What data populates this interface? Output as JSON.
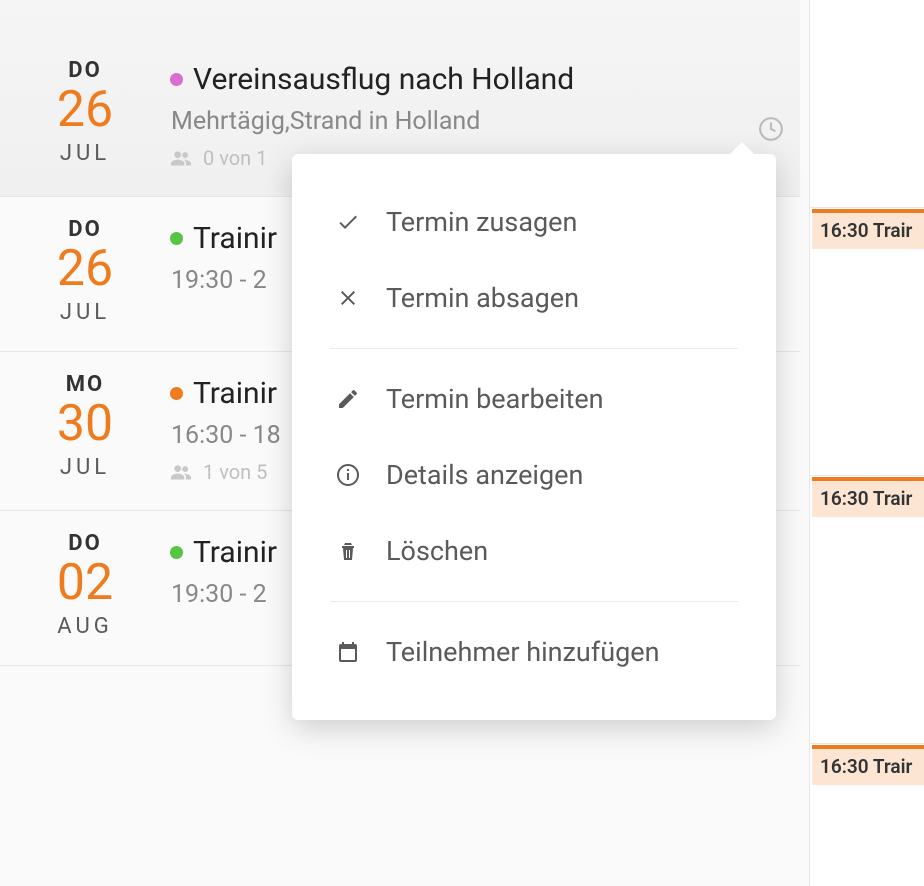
{
  "events": [
    {
      "weekday": "DO",
      "day": "26",
      "month": "JUL",
      "dot_color": "pink",
      "title": "Vereinsausflug nach Holland",
      "subtitle": "Mehrtägig,Strand in Holland",
      "attendees": "0 von 1"
    },
    {
      "weekday": "DO",
      "day": "26",
      "month": "JUL",
      "dot_color": "green",
      "title": "Trainir",
      "subtitle": "19:30 - 2",
      "attendees": null
    },
    {
      "weekday": "MO",
      "day": "30",
      "month": "JUL",
      "dot_color": "orange",
      "title": "Trainir",
      "subtitle": "16:30 - 18",
      "attendees": "1 von 5"
    },
    {
      "weekday": "DO",
      "day": "02",
      "month": "AUG",
      "dot_color": "green",
      "title": "Trainir",
      "subtitle": "19:30 - 2",
      "attendees": null
    }
  ],
  "popup": {
    "accept": "Termin zusagen",
    "decline": "Termin absagen",
    "edit": "Termin bearbeiten",
    "details": "Details anzeigen",
    "delete": "Löschen",
    "add_participants": "Teilnehmer hinzufügen"
  },
  "right_chips": [
    {
      "label": "16:30 Trair"
    },
    {
      "label": "16:30 Trair"
    },
    {
      "label": "16:30 Trair"
    }
  ]
}
